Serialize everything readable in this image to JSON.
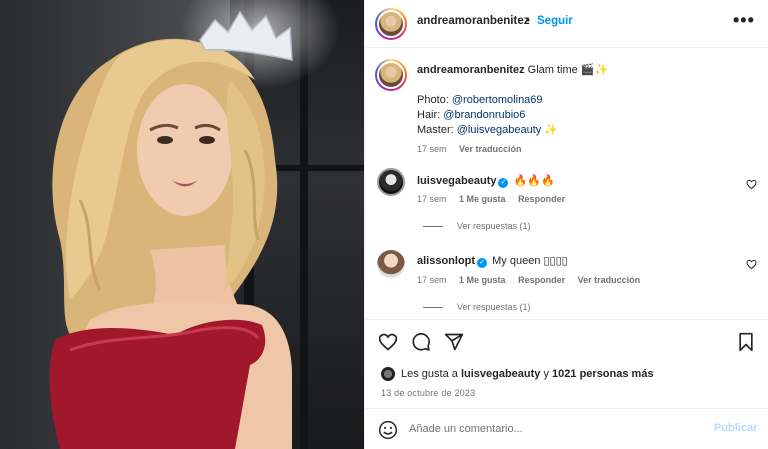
{
  "post": {
    "username": "andreamoranbenitez",
    "separator": "•",
    "follow_label": "Seguir",
    "more_label": "•••"
  },
  "caption": {
    "username": "andreamoranbenitez",
    "text": "Glam time",
    "emoji1": "🎬",
    "emoji2": "✨",
    "photo_label": "Photo:",
    "photo_mention": "@robertomolina69",
    "hair_label": "Hair:",
    "hair_mention": "@brandonrubio6",
    "master_label": "Master:",
    "master_mention": "@luisvegabeauty",
    "master_emoji": "✨",
    "time": "17 sem",
    "translate": "Ver traducción"
  },
  "comments": [
    {
      "username": "luisvegabeauty",
      "text": "🔥🔥🔥",
      "time": "17 sem",
      "likes": "1 Me gusta",
      "reply": "Responder",
      "view_replies": "Ver respuestas (1)"
    },
    {
      "username": "alissonlopt",
      "text": "My queen ▯▯▯▯",
      "time": "17 sem",
      "likes": "1 Me gusta",
      "reply": "Responder",
      "translate": "Ver traducción",
      "view_replies": "Ver respuestas (1)"
    }
  ],
  "likes": {
    "prefix": "Les gusta a",
    "user": "luisvegabeauty",
    "connector": "y",
    "others": "1021 personas más"
  },
  "date": "13 de octubre de 2023",
  "composer": {
    "placeholder": "Añade un comentario...",
    "publish_label": "Publicar"
  },
  "icons": {
    "like": "heart-icon",
    "comment": "comment-icon",
    "share": "share-icon",
    "save": "bookmark-icon",
    "emoji": "emoji-icon"
  },
  "colors": {
    "link": "#0095f6",
    "mention": "#00376b",
    "muted": "#737373"
  }
}
